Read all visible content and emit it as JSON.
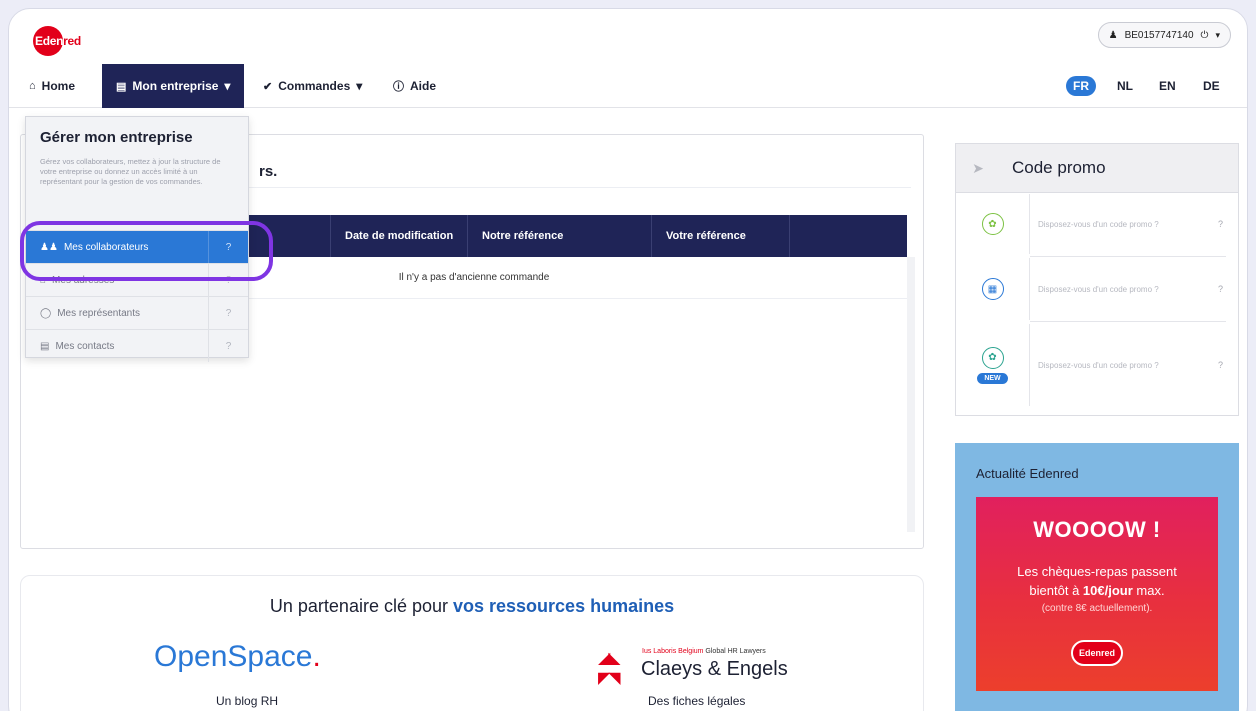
{
  "header": {
    "logo_prefix": "Eden",
    "logo_suffix": "red",
    "account_id": "BE0157747140",
    "account_user_icon": "user-icon",
    "account_power_icon": "power-icon",
    "account_caret": "▾"
  },
  "nav": {
    "home": "Home",
    "company": "Mon entreprise",
    "orders": "Commandes",
    "help": "Aide",
    "caret": "▾"
  },
  "languages": [
    "FR",
    "NL",
    "EN",
    "DE"
  ],
  "active_language": "FR",
  "dropdown": {
    "title": "Gérer mon entreprise",
    "description": "Gérez vos collaborateurs, mettez à jour la structure de votre entreprise ou donnez un accès limité à un représentant pour la gestion de vos commandes.",
    "items": [
      {
        "label": "Mes collaborateurs",
        "icon": "users-icon",
        "active": true
      },
      {
        "label": "Mes adresses",
        "icon": "home-icon",
        "active": false
      },
      {
        "label": "Mes représentants",
        "icon": "user-icon",
        "active": false
      },
      {
        "label": "Mes contacts",
        "icon": "contact-card-icon",
        "active": false
      }
    ]
  },
  "main": {
    "title_fragment": "rs.",
    "columns": [
      "Date de modification",
      "Notre référence",
      "Votre référence"
    ],
    "empty_message": "Il n'y a pas d'ancienne commande"
  },
  "promo": {
    "title": "Code promo",
    "items": [
      {
        "text": "Disposez-vous d'un code promo ?",
        "icon": "leaf-icon",
        "color": "#7cc242"
      },
      {
        "text": "Disposez-vous d'un code promo ?",
        "icon": "gift-icon",
        "color": "#2a78d6"
      },
      {
        "text": "Disposez-vous d'un code promo ?",
        "icon": "leaf-card-icon",
        "color": "#2aa38f",
        "badge": "NEW"
      }
    ]
  },
  "news": {
    "title": "Actualité Edenred",
    "banner_big": "WOOOOW !",
    "banner_line1": "Les chèques-repas passent",
    "banner_line2_pre": "bientôt à ",
    "banner_line2_bold": "10€/jour",
    "banner_line2_post": " max.",
    "banner_line3": "(contre 8€ actuellement).",
    "banner_logo": "Edenred"
  },
  "partners": {
    "title_pre": "Un partenaire clé pour ",
    "title_highlight": "vos ressources humaines",
    "openspace_name": "OpenSpace",
    "openspace_dot": ".",
    "openspace_caption": "Un blog RH",
    "claeys_tagline_red": "Ius Laboris Belgium",
    "claeys_tagline": " Global HR Lawyers",
    "claeys_name": "Claeys & Engels",
    "claeys_caption": "Des fiches légales"
  },
  "colors": {
    "navy": "#1f2457",
    "accent_blue": "#2a78d6",
    "brand_red": "#e2001a",
    "highlight_purple": "#7f35e3"
  }
}
